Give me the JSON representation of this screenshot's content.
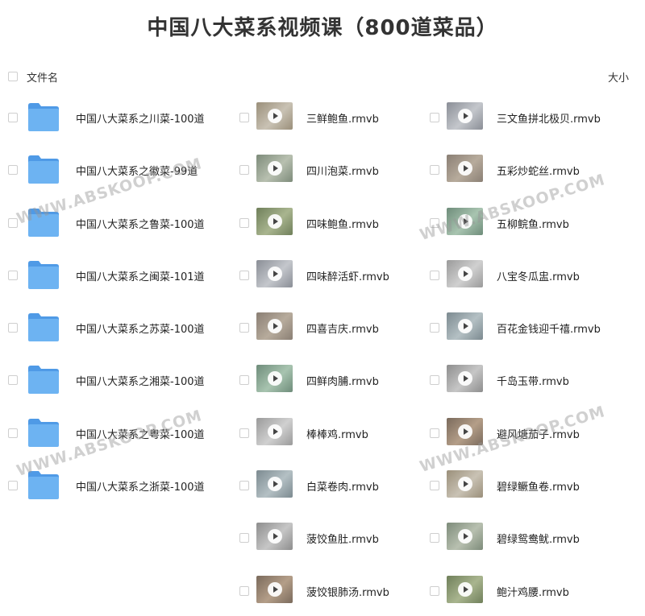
{
  "title": "中国八大菜系视频课（800道菜品）",
  "header": {
    "name_label": "文件名",
    "size_label": "大小"
  },
  "folders": [
    {
      "name": "中国八大菜系之川菜-100道"
    },
    {
      "name": "中国八大菜系之徽菜-99道"
    },
    {
      "name": "中国八大菜系之鲁菜-100道"
    },
    {
      "name": "中国八大菜系之闽菜-101道"
    },
    {
      "name": "中国八大菜系之苏菜-100道"
    },
    {
      "name": "中国八大菜系之湘菜-100道"
    },
    {
      "name": "中国八大菜系之粤菜-100道"
    },
    {
      "name": "中国八大菜系之浙菜-100道"
    }
  ],
  "videos_col2": [
    {
      "name": "三鲜鲍鱼.rmvb"
    },
    {
      "name": "四川泡菜.rmvb"
    },
    {
      "name": "四味鲍鱼.rmvb"
    },
    {
      "name": "四味醉活虾.rmvb"
    },
    {
      "name": "四喜吉庆.rmvb"
    },
    {
      "name": "四鲜肉脯.rmvb"
    },
    {
      "name": "棒棒鸡.rmvb"
    },
    {
      "name": "白菜卷肉.rmvb"
    },
    {
      "name": "菠饺鱼肚.rmvb"
    },
    {
      "name": "菠饺银肺汤.rmvb"
    }
  ],
  "videos_col3": [
    {
      "name": "三文鱼拼北极贝.rmvb"
    },
    {
      "name": "五彩炒蛇丝.rmvb"
    },
    {
      "name": "五柳鲩鱼.rmvb"
    },
    {
      "name": "八宝冬瓜盅.rmvb"
    },
    {
      "name": "百花金钱迎千禧.rmvb"
    },
    {
      "name": "千岛玉带.rmvb"
    },
    {
      "name": "避风塘茄子.rmvb"
    },
    {
      "name": "碧绿鳜鱼卷.rmvb"
    },
    {
      "name": "碧绿鸳鸯鱿.rmvb"
    },
    {
      "name": "鲍汁鸡腰.rmvb"
    }
  ],
  "watermark": "WWW.ABSKOOP.COM",
  "colors": {
    "folder": "#6db3f2",
    "folder_dark": "#4f9ae6",
    "checkbox_border": "#cfcfcf"
  },
  "icons": {
    "folder": "folder-icon",
    "video": "video-thumbnail-play-icon"
  }
}
